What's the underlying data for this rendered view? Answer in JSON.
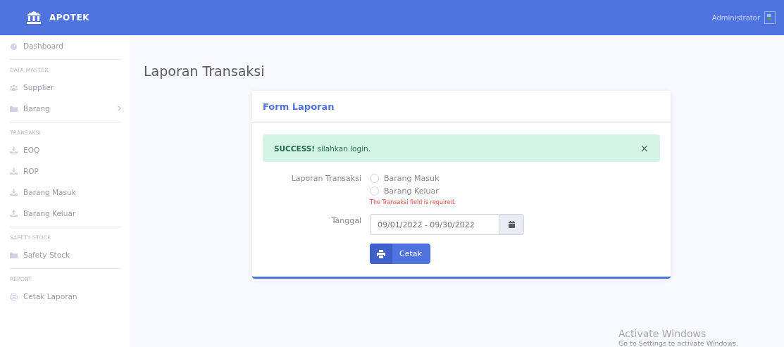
{
  "navbar": {
    "brand": "APOTEK",
    "user": "Administrator"
  },
  "sidebar": {
    "items": [
      {
        "kind": "link",
        "label": "Dashboard"
      },
      {
        "kind": "divider"
      },
      {
        "kind": "heading",
        "label": "DATA MASTER"
      },
      {
        "kind": "link",
        "label": "Supplier"
      },
      {
        "kind": "link",
        "label": "Barang",
        "expandable": true
      },
      {
        "kind": "divider"
      },
      {
        "kind": "heading",
        "label": "TRANSAKSI"
      },
      {
        "kind": "link",
        "label": "EOQ"
      },
      {
        "kind": "link",
        "label": "ROP"
      },
      {
        "kind": "link",
        "label": "Barang Masuk"
      },
      {
        "kind": "link",
        "label": "Barang Keluar"
      },
      {
        "kind": "divider"
      },
      {
        "kind": "heading",
        "label": "SAFETY STOCK"
      },
      {
        "kind": "link",
        "label": "Safety Stock"
      },
      {
        "kind": "divider"
      },
      {
        "kind": "heading",
        "label": "REPORT"
      },
      {
        "kind": "link",
        "label": "Cetak Laporan"
      }
    ]
  },
  "page_title": "Laporan Transaksi",
  "card": {
    "title": "Form Laporan",
    "alert": {
      "text": "**SUCCESS!** silahkan login.",
      "close": "×"
    },
    "transaksi": {
      "label": "Laporan Transaksi",
      "options": [
        {
          "label": "Barang Masuk",
          "checked": false
        },
        {
          "label": "Barang Keluar",
          "checked": false
        }
      ],
      "error": "The Transaksi field is required."
    },
    "tanggal": {
      "label": "Tanggal",
      "value": "09/01/2022 - 09/30/2022"
    },
    "button": "Cetak"
  },
  "os_notice": {
    "title": "Activate Windows",
    "text": "Go to Settings to activate Windows."
  }
}
